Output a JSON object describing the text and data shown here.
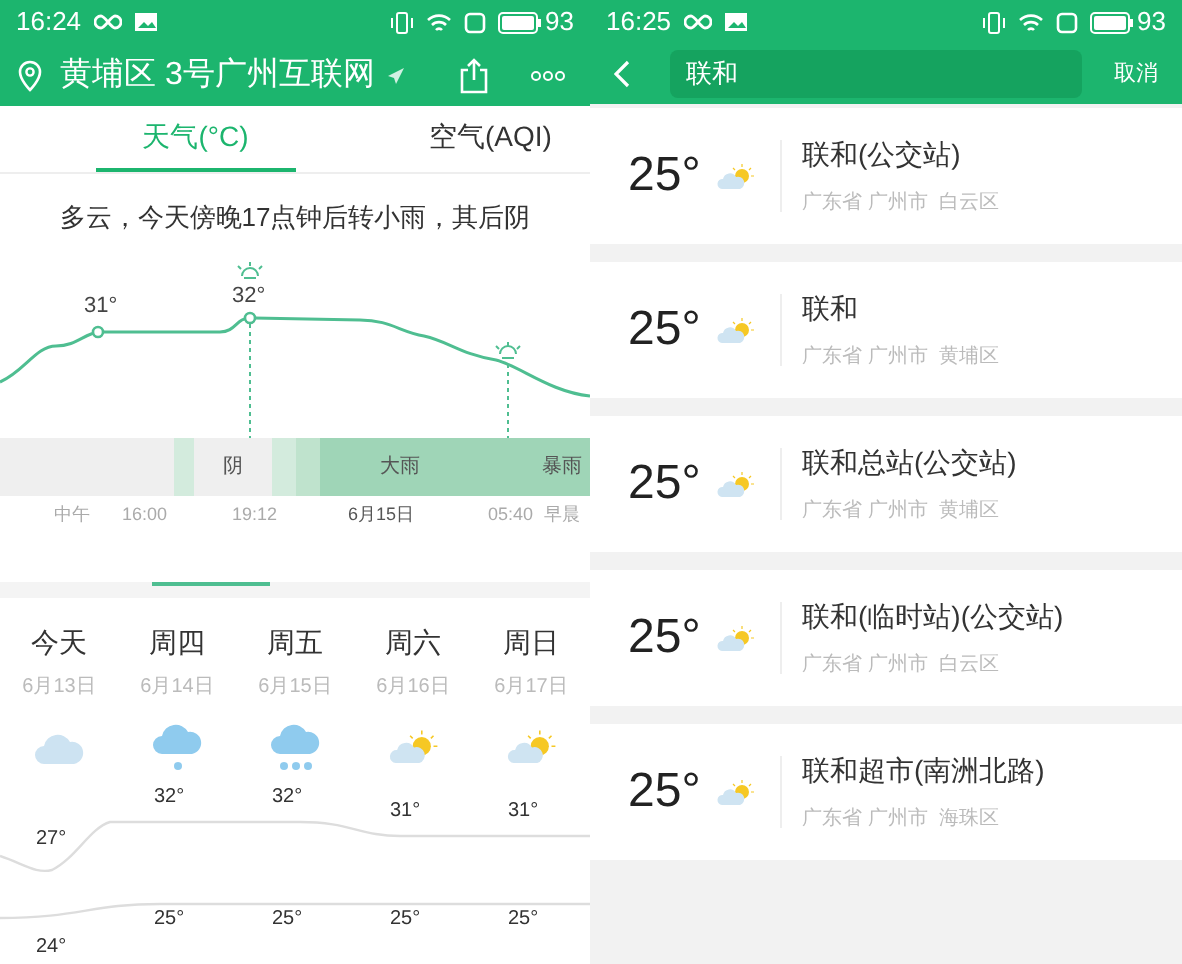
{
  "left": {
    "status_bar": {
      "time": "16:24",
      "battery": "93"
    },
    "header": {
      "title": "黄埔区 3号广州互联网"
    },
    "tabs": [
      {
        "label": "天气(°C)",
        "selected": true
      },
      {
        "label": "空气(AQI)",
        "selected": false
      }
    ],
    "summary": "多云，今天傍晚17点钟后转小雨，其后阴",
    "hourly": {
      "point_labels": [
        "31°",
        "32°"
      ]
    },
    "timeline": [
      {
        "kind": "plain"
      },
      {
        "kind": "light"
      },
      {
        "kind": "plain",
        "label": "阴"
      },
      {
        "kind": "light"
      },
      {
        "kind": "mid"
      },
      {
        "kind": "rain",
        "label": "大雨"
      },
      {
        "kind": "rain",
        "label": "暴雨"
      }
    ],
    "time_labels": [
      {
        "text": "中午",
        "selected": false
      },
      {
        "text": "16:00",
        "selected": false
      },
      {
        "text": "19:12",
        "selected": false
      },
      {
        "text": "6月15日",
        "selected": true
      },
      {
        "text": "05:40",
        "selected": false
      },
      {
        "text": "早晨",
        "selected": false
      }
    ],
    "days": [
      {
        "day": "今天",
        "date": "6月13日",
        "kind": "cloud",
        "low": "24°",
        "high_today": "27°"
      },
      {
        "day": "周四",
        "date": "6月14日",
        "kind": "light-rain",
        "high": "32°",
        "low": "25°"
      },
      {
        "day": "周五",
        "date": "6月15日",
        "kind": "heavy-rain",
        "high": "32°",
        "low": "25°"
      },
      {
        "day": "周六",
        "date": "6月16日",
        "kind": "partly-sunny",
        "high": "31°",
        "low": "25°"
      },
      {
        "day": "周日",
        "date": "6月17日",
        "kind": "partly-sunny",
        "high": "31°",
        "low": "25°"
      }
    ]
  },
  "right": {
    "status_bar": {
      "time": "16:25",
      "battery": "93"
    },
    "search": {
      "value": "联和",
      "cancel": "取消"
    },
    "results": [
      {
        "temp": "25°",
        "name": "联和(公交站)",
        "region": "广东省 广州市  白云区"
      },
      {
        "temp": "25°",
        "name": "联和",
        "region": "广东省 广州市  黄埔区"
      },
      {
        "temp": "25°",
        "name": "联和总站(公交站)",
        "region": "广东省 广州市  黄埔区"
      },
      {
        "temp": "25°",
        "name": "联和(临时站)(公交站)",
        "region": "广东省 广州市  白云区"
      },
      {
        "temp": "25°",
        "name": "联和超市(南洲北路)",
        "region": "广东省 广州市  海珠区"
      }
    ]
  }
}
